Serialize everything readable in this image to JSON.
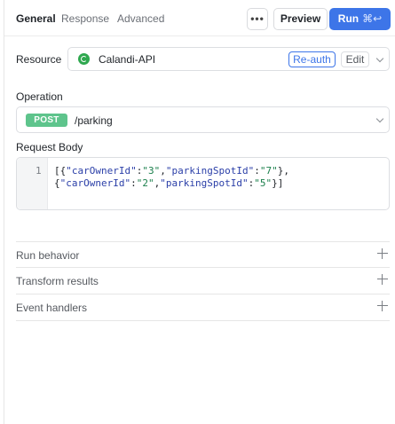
{
  "tabs": [
    {
      "label": "General",
      "active": true
    },
    {
      "label": "Response",
      "active": false
    },
    {
      "label": "Advanced",
      "active": false
    }
  ],
  "toolbar": {
    "more_icon": "ellipsis-icon",
    "preview_label": "Preview",
    "run_label": "Run",
    "run_shortcut": "⌘↩",
    "run_color": "#3d75e8"
  },
  "resource": {
    "label": "Resource",
    "icon": "api-resource-icon",
    "icon_color": "#2fa84f",
    "name": "Calandi-API",
    "reauth_label": "Re-auth",
    "edit_label": "Edit"
  },
  "operation": {
    "label": "Operation",
    "method": "POST",
    "method_color": "#5ec48c",
    "path": "/parking"
  },
  "request_body": {
    "label": "Request Body",
    "line_numbers": [
      "1"
    ],
    "tokens": {
      "open": "[{",
      "k1": "\"carOwnerId\"",
      "colon": ":",
      "v1": "\"3\"",
      "comma": ",",
      "k2": "\"parkingSpotId\"",
      "v2": "\"7\"",
      "close_obj": "},",
      "open_obj": "{",
      "k3": "\"carOwnerId\"",
      "v3": "\"2\"",
      "k4": "\"parkingSpotId\"",
      "v4": "\"5\"",
      "close": "}]"
    }
  },
  "sections": [
    {
      "label": "Run behavior"
    },
    {
      "label": "Transform results"
    },
    {
      "label": "Event handlers"
    }
  ]
}
